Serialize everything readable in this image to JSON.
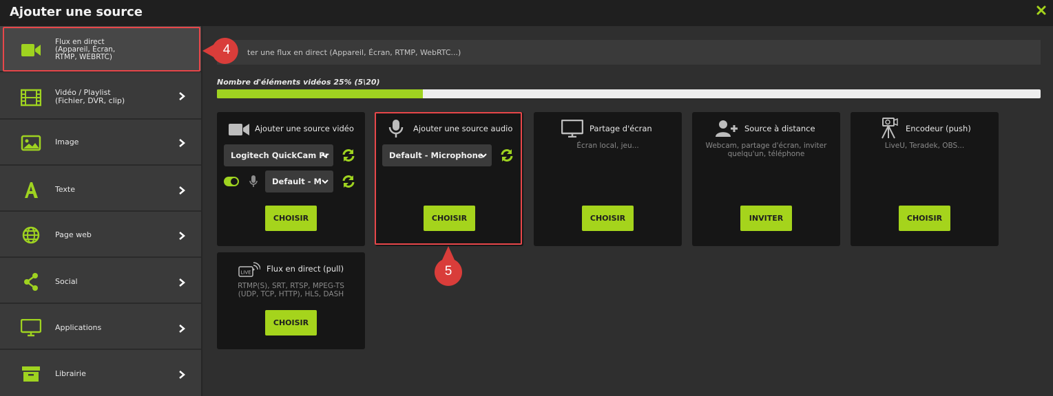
{
  "window": {
    "title": "Ajouter une source",
    "close_icon": "close-icon"
  },
  "colors": {
    "accent": "#a5d41c",
    "highlight": "#e8474a",
    "card_bg": "#161616",
    "sidebar_bg": "#3a3a3a"
  },
  "sidebar": {
    "items": [
      {
        "label": "Flux en direct\n(Appareil, Écran,\nRTMP, WEBRTC)",
        "icon": "video-camera-icon"
      },
      {
        "label": "Vidéo / Playlist\n(Fichier, DVR, clip)",
        "icon": "film-icon"
      },
      {
        "label": "Image",
        "icon": "image-icon"
      },
      {
        "label": "Texte",
        "icon": "text-icon"
      },
      {
        "label": "Page web",
        "icon": "globe-icon"
      },
      {
        "label": "Social",
        "icon": "share-icon"
      },
      {
        "label": "Applications",
        "icon": "monitor-icon"
      },
      {
        "label": "Librairie",
        "icon": "archive-icon"
      }
    ]
  },
  "main": {
    "search_text": "ter une flux en direct (Appareil, Écran, RTMP, WebRTC...)",
    "quota_label": "Nombre d'éléments vidéos 25% (5\\20)",
    "quota_percent": 25,
    "cards": [
      {
        "title": "Ajouter une source vidéo",
        "icon": "video-camera-icon",
        "video_select": "Logitech QuickCam Pr",
        "audio_select": "Default - M",
        "audio_toggle_on": true,
        "button": "CHOISIR"
      },
      {
        "title": "Ajouter une source audio",
        "icon": "microphone-icon",
        "audio_select": "Default - Microphone",
        "button": "CHOISIR"
      },
      {
        "title": "Partage d'écran",
        "icon": "monitor-icon",
        "desc": "Écran local, jeu...",
        "button": "CHOISIR"
      },
      {
        "title": "Source à distance",
        "icon": "add-user-icon",
        "desc": "Webcam, partage d'écran, inviter\nquelqu'un, téléphone",
        "button": "INVITER"
      },
      {
        "title": "Encodeur (push)",
        "icon": "tripod-camera-icon",
        "desc": "LiveU, Teradek, OBS...",
        "button": "CHOISIR"
      },
      {
        "title": "Flux en direct (pull)",
        "icon": "live-icon",
        "desc": "RTMP(S), SRT, RTSP, MPEG-TS\n(UDP, TCP, HTTP), HLS, DASH",
        "button": "CHOISIR"
      }
    ]
  },
  "annotations": {
    "badge_1": "4",
    "badge_2": "5"
  }
}
